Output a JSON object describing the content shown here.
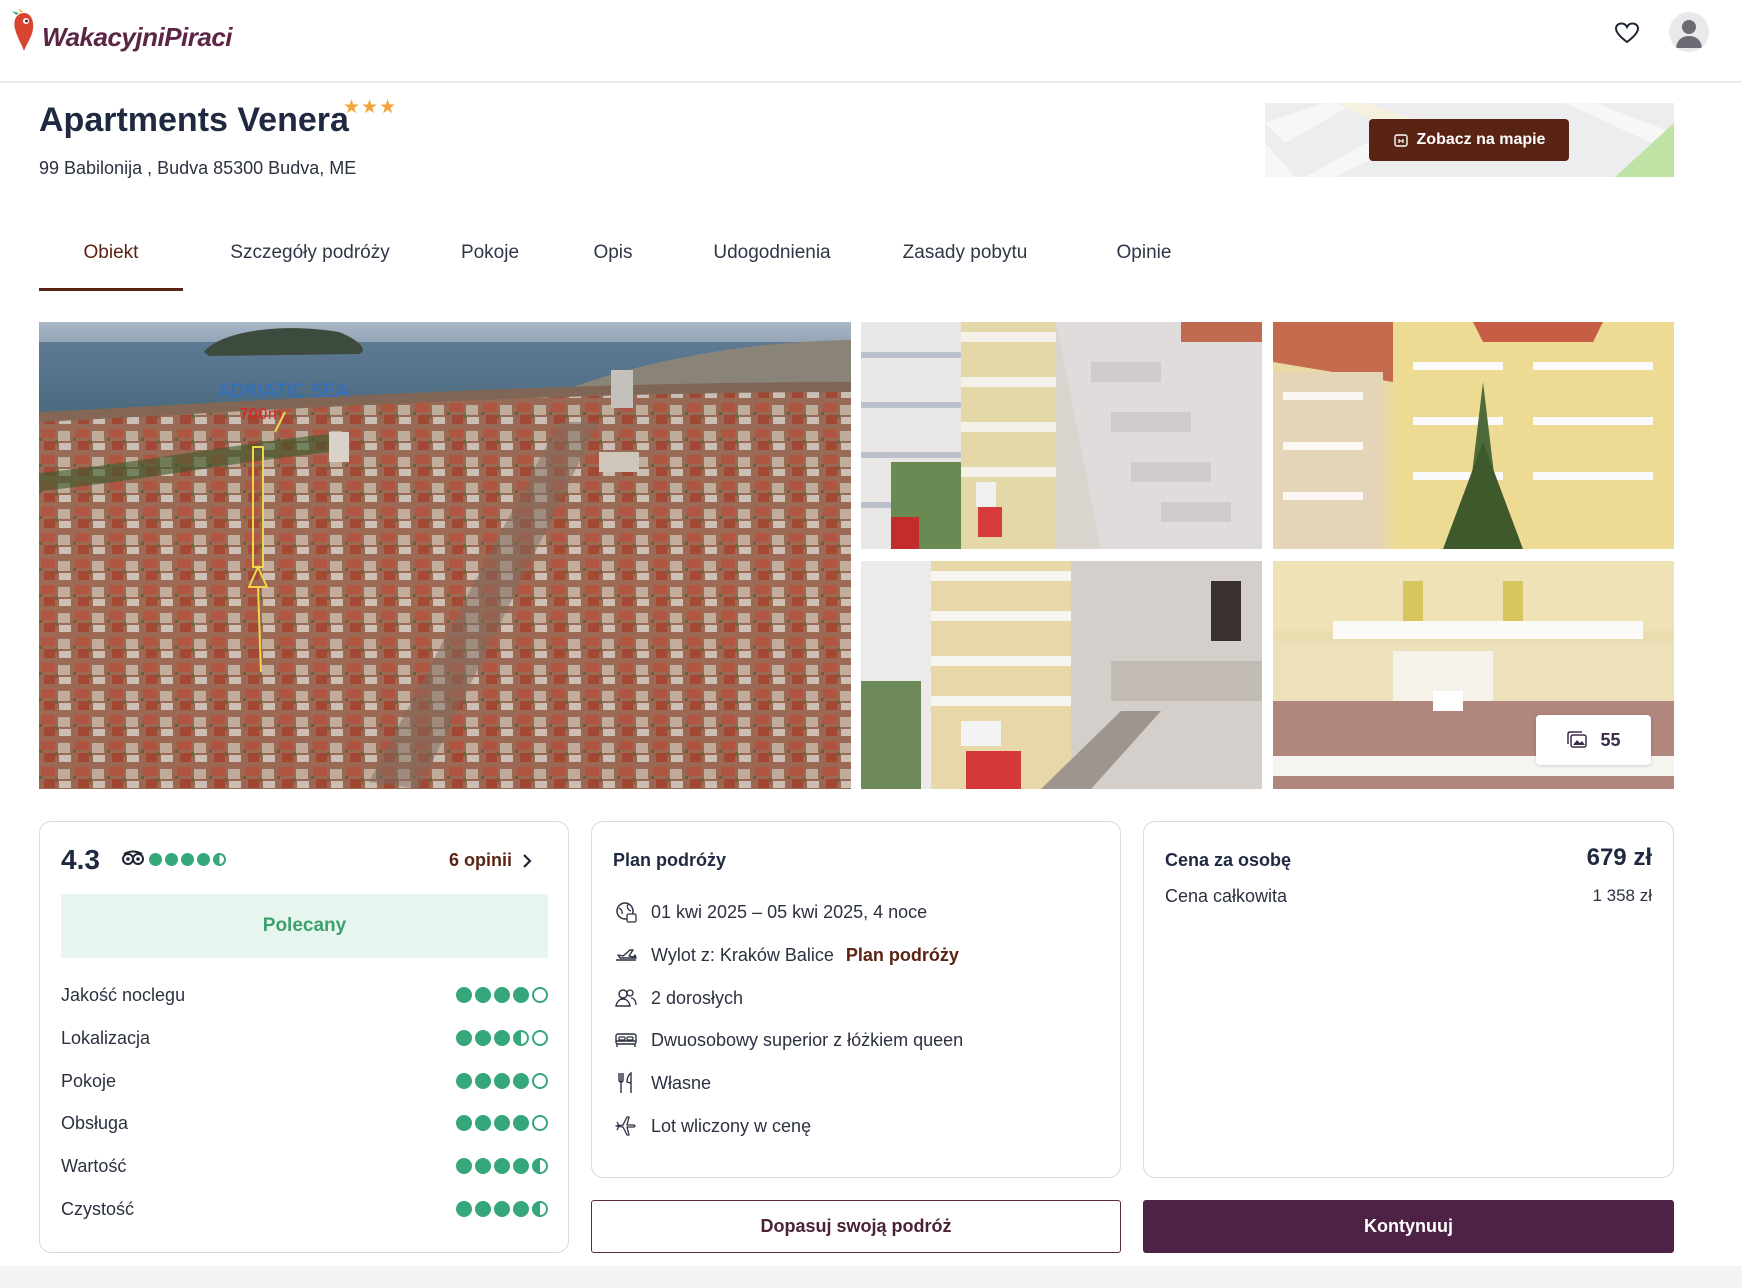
{
  "header": {
    "logo_text": "WakacyjniPiraci",
    "favorite_icon": "heart-icon",
    "avatar_icon": "user-icon"
  },
  "hotel": {
    "name": "Apartments Venera",
    "stars": "★★★",
    "address": "99 Babilonija , Budva 85300 Budva, ME"
  },
  "map": {
    "button_label": "Zobacz na mapie"
  },
  "tabs": [
    {
      "label": "Obiekt",
      "active": true
    },
    {
      "label": "Szczegóły podróży"
    },
    {
      "label": "Pokoje"
    },
    {
      "label": "Opis"
    },
    {
      "label": "Udogodnienia"
    },
    {
      "label": "Zasady pobytu"
    },
    {
      "label": "Opinie"
    }
  ],
  "gallery": {
    "photo_count": "55",
    "main_overlay_text": "ADRIATIC  SEA",
    "main_overlay_distance": "700m"
  },
  "rating": {
    "score": "4.3",
    "tripadvisor_bubbles": 4.5,
    "reviews_link": "6 opinii",
    "badge": "Polecany",
    "criteria": [
      {
        "label": "Jakość noclegu",
        "value": 4
      },
      {
        "label": "Lokalizacja",
        "value": 3.5
      },
      {
        "label": "Pokoje",
        "value": 4
      },
      {
        "label": "Obsługa",
        "value": 4
      },
      {
        "label": "Wartość",
        "value": 4.5
      },
      {
        "label": "Czystość",
        "value": 4.5
      }
    ]
  },
  "plan": {
    "title": "Plan podróży",
    "dates": "01 kwi 2025 – 05 kwi 2025, 4 noce",
    "departure": "Wylot z: Kraków Balice",
    "departure_link": "Plan podróży",
    "guests": "2 dorosłych",
    "room": "Dwuosobowy superior z łóżkiem queen",
    "board": "Własne",
    "flight": "Lot wliczony w cenę"
  },
  "price": {
    "per_person_label": "Cena za osobę",
    "per_person_value": "679 zł",
    "total_label": "Cena całkowita",
    "total_value": "1 358 zł"
  },
  "actions": {
    "customize_label": "Dopasuj swoją podróż",
    "continue_label": "Kontynuuj"
  },
  "colors": {
    "brand_dark": "#5a2414",
    "primary_button": "#4d2245",
    "rating_green": "#35a77b",
    "stars": "#f2a33a"
  }
}
